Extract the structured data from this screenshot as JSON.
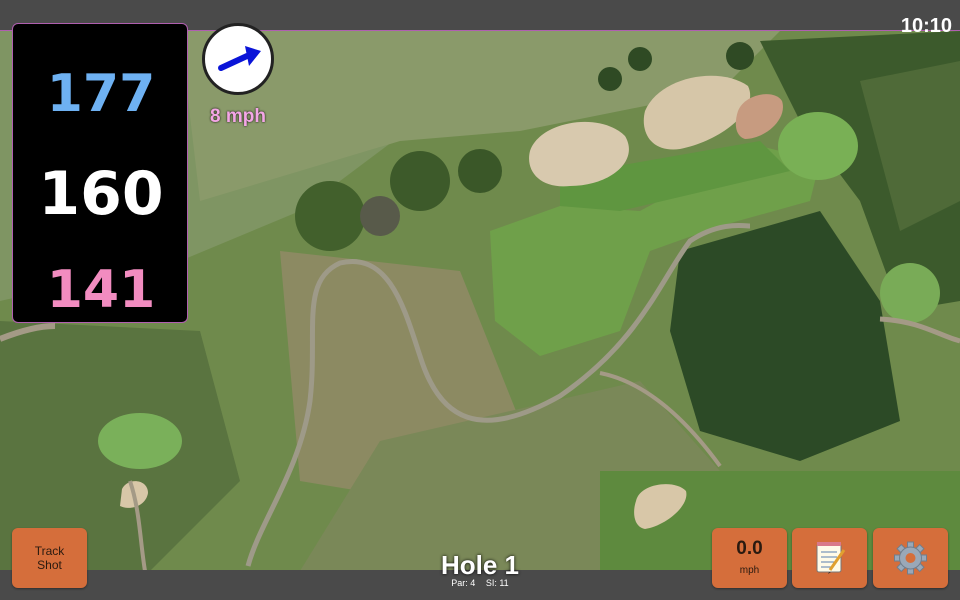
{
  "status_bar": {
    "time": "10:10"
  },
  "distances": {
    "back": "177",
    "middle": "160",
    "front": "141"
  },
  "wind": {
    "speed": "8 mph",
    "arrow_icon": "wind-arrow-icon",
    "arrow_color": "#0a14d8"
  },
  "hole": {
    "title": "Hole 1",
    "par": "Par: 4",
    "stroke_index": "SI: 11"
  },
  "buttons": {
    "track_shot_line1": "Track",
    "track_shot_line2": "Shot",
    "speed_value": "0.0",
    "speed_unit": "mph",
    "notes_icon": "notepad-icon",
    "settings_icon": "gear-icon"
  },
  "colors": {
    "accent_border": "#b05fb0",
    "button": "#d56e3b",
    "back_distance": "#6eb1f2",
    "front_distance": "#f28cc0",
    "wind_text": "#f4a6e6"
  }
}
